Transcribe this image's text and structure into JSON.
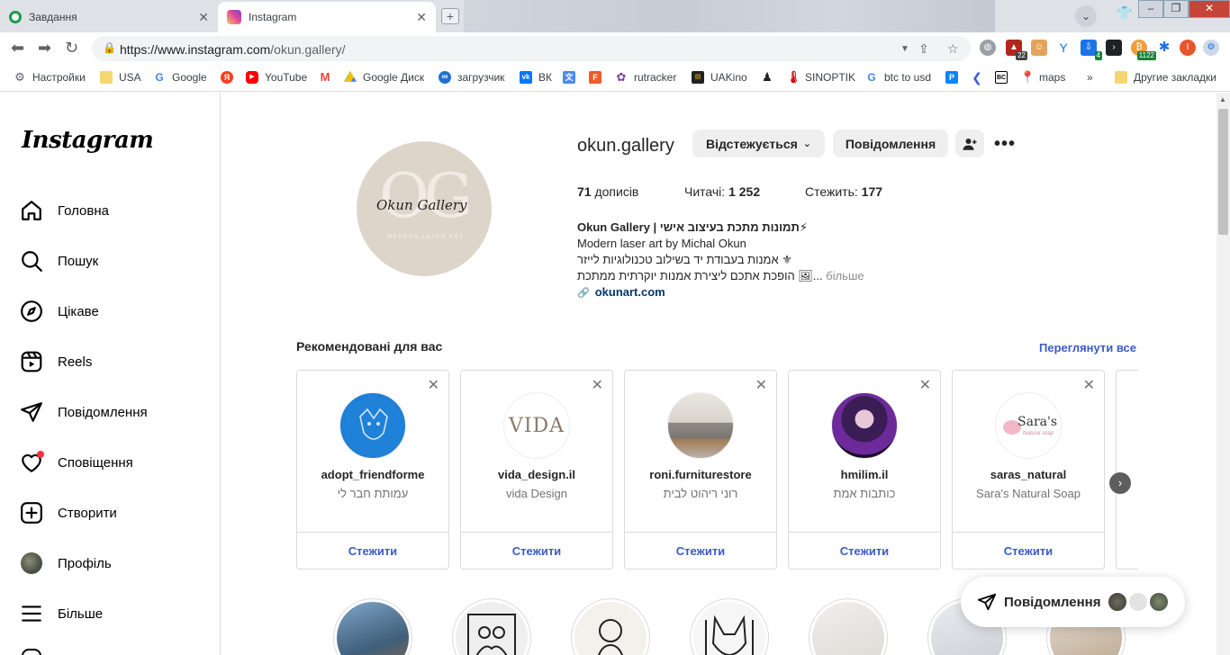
{
  "browser": {
    "tabs": [
      {
        "title": "Завдання",
        "active": false
      },
      {
        "title": "Instagram",
        "active": true
      }
    ],
    "url_host": "https://www.instagram.com",
    "url_path": "/okun.gallery/",
    "extension_badges": {
      "ext1": "22",
      "ext2": "4",
      "ext3": "1122"
    },
    "profile_initial": "I",
    "bookmarks": [
      {
        "label": "Настройки",
        "icon": "gear-icon"
      },
      {
        "label": "USA",
        "icon": "folder-icon"
      },
      {
        "label": "Google",
        "icon": "google-icon"
      },
      {
        "label": "",
        "icon": "yandex-icon"
      },
      {
        "label": "YouTube",
        "icon": "youtube-icon"
      },
      {
        "label": "",
        "icon": "gmail-icon"
      },
      {
        "label": "Google Диск",
        "icon": "drive-icon"
      },
      {
        "label": "загрузчик",
        "icon": "infinity-icon"
      },
      {
        "label": "ВК",
        "icon": "vk-icon"
      },
      {
        "label": "",
        "icon": "translate-icon"
      },
      {
        "label": "",
        "icon": "f-icon"
      },
      {
        "label": "rutracker",
        "icon": "rutracker-icon"
      },
      {
        "label": "UAKino",
        "icon": "film-icon"
      },
      {
        "label": "",
        "icon": "figure-icon"
      },
      {
        "label": "SINOPTIK",
        "icon": "thermometer-icon"
      },
      {
        "label": "btc to usd",
        "icon": "google-icon"
      },
      {
        "label": "",
        "icon": "p-icon"
      },
      {
        "label": "",
        "icon": "chevron-blue-icon"
      },
      {
        "label": "",
        "icon": "bc-icon"
      },
      {
        "label": "maps",
        "icon": "maps-icon"
      }
    ],
    "bookmarks_overflow": "»",
    "other_bookmarks": "Другие закладки"
  },
  "instagram": {
    "logo": "Instagram",
    "nav": [
      {
        "label": "Головна",
        "icon": "home-icon"
      },
      {
        "label": "Пошук",
        "icon": "search-icon"
      },
      {
        "label": "Цікаве",
        "icon": "compass-icon"
      },
      {
        "label": "Reels",
        "icon": "reels-icon"
      },
      {
        "label": "Повідомлення",
        "icon": "messenger-icon"
      },
      {
        "label": "Сповіщення",
        "icon": "heart-icon"
      },
      {
        "label": "Створити",
        "icon": "plus-square-icon"
      },
      {
        "label": "Профіль",
        "icon": "avatar"
      },
      {
        "label": "Більше",
        "icon": "menu-icon"
      }
    ],
    "profile": {
      "avatar_sig": "Okun Gallery",
      "avatar_tag": "MODERN LASER ART",
      "username": "okun.gallery",
      "following_button": "Відстежується",
      "message_button": "Повідомлення",
      "posts_count": "71",
      "posts_label": "дописів",
      "followers_label": "Читачі:",
      "followers_count": "1 252",
      "following_label": "Стежить:",
      "following_count": "177",
      "bio_name": "Okun Gallery | תמונות מתכת בעיצוב אישי⚡",
      "bio_line1": "Modern laser art by Michal Okun",
      "bio_line2": "אמנות בעבודת יד בשילוב טכנולוגיות לייזר ⚜",
      "bio_line3": "הופכת אתכם ליצירת אמנות יוקרתית ממתכת 🖼...",
      "bio_more": "більше",
      "bio_link": "okunart.com"
    },
    "suggestions": {
      "title": "Рекомендовані для вас",
      "see_all": "Переглянути все",
      "cards": [
        {
          "username": "adopt_friendforme",
          "subtitle": "עמותת חבר לי",
          "follow": "Стежити"
        },
        {
          "username": "vida_design.il",
          "subtitle": "vida Design",
          "follow": "Стежити",
          "avatar_text": "VIDA"
        },
        {
          "username": "roni.furniturestore",
          "subtitle": "רוני ריהוט לבית",
          "follow": "Стежити"
        },
        {
          "username": "hmilim.il",
          "subtitle": "כותבות אמת",
          "follow": "Стежити"
        },
        {
          "username": "saras_natural",
          "subtitle": "Sara's Natural Soap",
          "follow": "Стежити",
          "avatar_text": "Sara's",
          "avatar_subtext": "Natural soap"
        }
      ]
    },
    "messages_pill": {
      "label": "Повідомлення"
    }
  },
  "colors": {
    "link_blue": "#385cc6",
    "notif_red": "#ff3040",
    "border": "#dbdbdb"
  }
}
